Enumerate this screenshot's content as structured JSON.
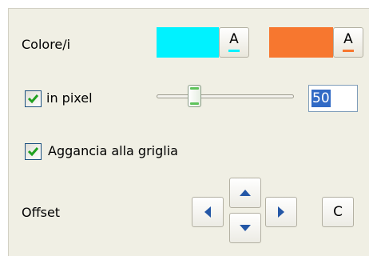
{
  "colors": {
    "label": "Colore/i",
    "primary": {
      "swatch": "#00f2ff",
      "glyph": "A",
      "underline": "#00f2ff"
    },
    "secondary": {
      "swatch": "#f7772f",
      "glyph": "A",
      "underline": "#f7772f"
    }
  },
  "pixel": {
    "checkbox_label": "in pixel",
    "checked": true,
    "slider_level": 0.25,
    "value": "50"
  },
  "snap": {
    "checkbox_label": "Aggancia alla griglia",
    "checked": true
  },
  "offset": {
    "label": "Offset",
    "up_icon": "triangle-up-icon",
    "down_icon": "triangle-down-icon",
    "left_icon": "triangle-left-icon",
    "right_icon": "triangle-right-icon",
    "center_label": "C"
  },
  "theme": {
    "arrow_color": "#2457a6",
    "check_color": "#21a121"
  }
}
